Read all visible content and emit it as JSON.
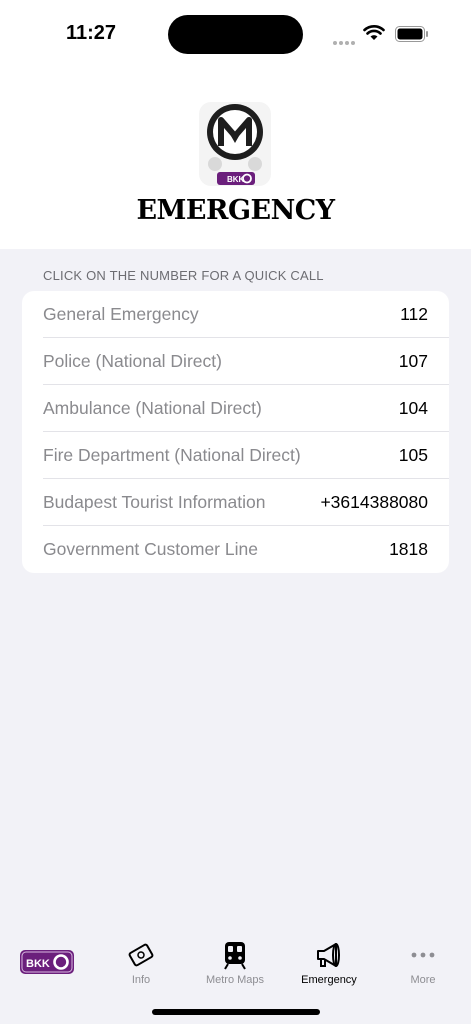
{
  "status_bar": {
    "time": "11:27"
  },
  "header": {
    "title": "EMERGENCY",
    "logo_badge": "BKK"
  },
  "section_header": "CLICK ON THE NUMBER FOR A QUICK CALL",
  "contacts": [
    {
      "label": "General Emergency",
      "number": "112"
    },
    {
      "label": "Police (National Direct)",
      "number": "107"
    },
    {
      "label": "Ambulance (National Direct)",
      "number": "104"
    },
    {
      "label": "Fire Department (National Direct)",
      "number": "105"
    },
    {
      "label": "Budapest Tourist Information",
      "number": "+3614388080"
    },
    {
      "label": "Government Customer Line",
      "number": "1818"
    }
  ],
  "tab_bar": {
    "brand_badge": "BKK",
    "tabs": [
      {
        "label": "Info",
        "icon": "ticket-icon"
      },
      {
        "label": "Metro Maps",
        "icon": "train-icon"
      },
      {
        "label": "Emergency",
        "icon": "megaphone-icon",
        "active": true
      },
      {
        "label": "More",
        "icon": "more-dots-icon"
      }
    ]
  },
  "colors": {
    "brand_purple": "#6b1f7c",
    "background": "#f2f2f7",
    "card": "#ffffff",
    "label_gray": "#8a8a8e"
  }
}
